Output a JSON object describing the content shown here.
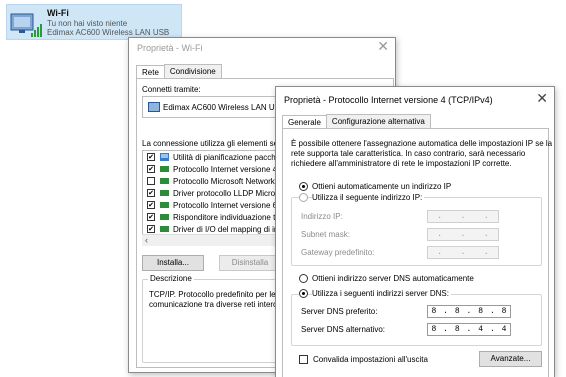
{
  "wifi_tile": {
    "name": "Wi-Fi",
    "status": "Tu non hai visto niente",
    "adapter": "Edimax AC600 Wireless LAN USB"
  },
  "back_dialog": {
    "title": "Proprietà - Wi-Fi",
    "tabs": [
      "Rete",
      "Condivisione"
    ],
    "connect_label": "Connetti tramite:",
    "adapter_name": "Edimax AC600 Wireless LAN USB",
    "items_label": "La connessione utilizza gli elementi segue",
    "items": [
      {
        "label": "Utilità di pianificazione pacchetti",
        "checked": "✔"
      },
      {
        "label": "Protocollo Internet versione 4 (T",
        "checked": "✔"
      },
      {
        "label": "Protocollo Microsoft Network Ad",
        "checked": ""
      },
      {
        "label": "Driver protocollo LLDP Microsoft",
        "checked": "✔"
      },
      {
        "label": "Protocollo Internet versione 6 (T",
        "checked": "✔"
      },
      {
        "label": "Risponditore individuazione topo",
        "checked": "✔"
      },
      {
        "label": "Driver di I/O del mapping di indiv",
        "checked": "✔"
      }
    ],
    "install_label": "Installa...",
    "uninstall_label": "Disinstalla",
    "desc_legend": "Descrizione",
    "desc_line1": "TCP/IP. Protocollo predefinito per le W",
    "desc_line2": "comunicazione tra diverse reti intercon"
  },
  "front_dialog": {
    "title": "Proprietà - Protocollo Internet versione 4 (TCP/IPv4)",
    "tabs": [
      "Generale",
      "Configurazione alternativa"
    ],
    "intro_line1": "È possibile ottenere l'assegnazione automatica delle impostazioni IP se la",
    "intro_line2": "rete supporta tale caratteristica. In caso contrario, sarà necessario",
    "intro_line3": "richiedere all'amministratore di rete le impostazioni IP corrette.",
    "auto_ip": "Ottieni automaticamente un indirizzo IP",
    "manual_ip": "Utilizza il seguente indirizzo IP:",
    "ip_label": "Indirizzo IP:",
    "mask_label": "Subnet mask:",
    "gateway_label": "Gateway predefinito:",
    "auto_dns": "Ottieni indirizzo server DNS automaticamente",
    "manual_dns": "Utilizza i seguenti indirizzi server DNS:",
    "preferred_dns_label": "Server DNS preferito:",
    "alternate_dns_label": "Server DNS alternativo:",
    "preferred_dns": [
      "8",
      "8",
      "8",
      "8"
    ],
    "alternate_dns": [
      "8",
      "8",
      "4",
      "4"
    ],
    "validate_label": "Convalida impostazioni all'uscita",
    "advanced_label": "Avanzate..."
  },
  "colors": {
    "tile_bg": "#cfe6f7",
    "button_bg": "#e1e1e1"
  }
}
